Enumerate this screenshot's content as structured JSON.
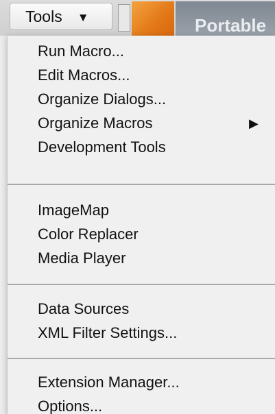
{
  "toolbar": {
    "tools_label": "Tools",
    "behind_text": "Portable"
  },
  "menu": {
    "groups": [
      {
        "items": [
          {
            "label": "Run Macro..."
          },
          {
            "label": "Edit Macros..."
          },
          {
            "label": "Organize Dialogs..."
          },
          {
            "label": "Organize Macros",
            "has_submenu": true
          },
          {
            "label": "Development Tools"
          }
        ]
      },
      {
        "items": [
          {
            "label": "ImageMap"
          },
          {
            "label": "Color Replacer"
          },
          {
            "label": "Media Player"
          }
        ]
      },
      {
        "items": [
          {
            "label": "Data Sources"
          },
          {
            "label": "XML Filter Settings..."
          }
        ]
      },
      {
        "items": [
          {
            "label": "Extension Manager..."
          },
          {
            "label": "Options..."
          }
        ]
      }
    ]
  },
  "icons": {
    "tools_caret": "caret-down-icon",
    "submenu_arrow": "triangle-right-icon"
  },
  "colors": {
    "menu_background": "#f0f0f0",
    "separator": "#a8a8a8",
    "document_icon": "#e37817"
  }
}
